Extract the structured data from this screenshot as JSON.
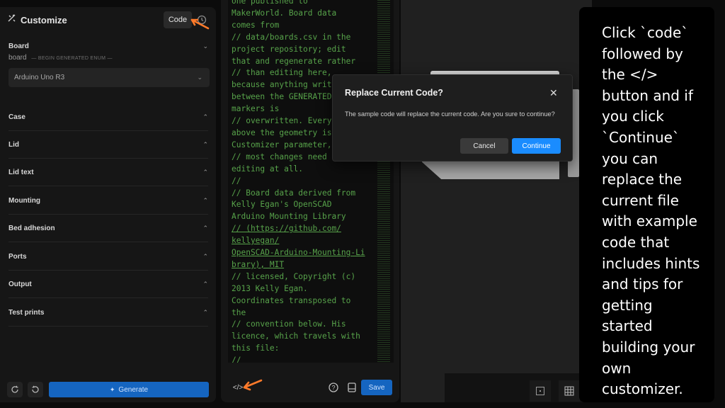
{
  "customize": {
    "title": "Customize",
    "code_button": "Code",
    "board": {
      "title": "Board",
      "param_name": "board",
      "param_hint": "— BEGIN GENERATED ENUM —",
      "selected": "Arduino Uno R3"
    },
    "sections": [
      "Case",
      "Lid",
      "Lid text",
      "Mounting",
      "Bed adhesion",
      "Ports",
      "Output",
      "Test prints"
    ],
    "generate_label": "Generate"
  },
  "code": {
    "lines": [
      "one published to",
      "MakerWorld. Board data",
      "comes from",
      "// data/boards.csv in the",
      "project repository; edit",
      "that and regenerate rather",
      "// than editing here,",
      "because anything writ",
      "between the GENERATED",
      "markers is",
      "// overwritten. Every",
      "above the geometry is",
      "Customizer parameter,",
      "// most changes need",
      "editing at all.",
      "//",
      "// Board data derived from",
      "Kelly Egan's OpenSCAD",
      "Arduino Mounting Library",
      "// (https://github.com/",
      "kellyegan/",
      "OpenSCAD-Arduino-Mounting-Li",
      "brary), MIT",
      "// licensed, Copyright (c)",
      "2013 Kelly Egan.",
      "Coordinates transposed to",
      "the",
      "// convention below. His",
      "licence, which travels with",
      "this file:",
      "//"
    ],
    "save_label": "Save",
    "embed_label": "</>"
  },
  "dialog": {
    "title": "Replace Current Code?",
    "message": "The sample code will replace the current code. Are you sure to continue?",
    "cancel_label": "Cancel",
    "continue_label": "Continue"
  },
  "instructions": {
    "text": "Click `code` followed by the </> button and if you click `Continue` you can replace the current file with example code that includes hints and tips for getting started building your own customizer."
  },
  "colors": {
    "accent": "#1a8cff",
    "generate": "#1565c0",
    "code_text": "#57a24a",
    "arrow": "#ff7a2a"
  }
}
